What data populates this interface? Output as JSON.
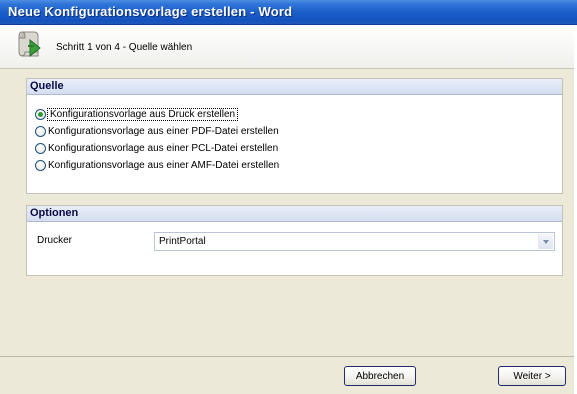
{
  "window": {
    "title": "Neue Konfigurationsvorlage erstellen - Word"
  },
  "header": {
    "step_text": "Schritt 1 von 4 - Quelle wählen",
    "icon": "wizard-scroll-arrow-icon"
  },
  "source_group": {
    "title": "Quelle",
    "options": [
      {
        "label": "Konfigurationsvorlage aus Druck erstellen",
        "selected": true
      },
      {
        "label": "Konfigurationsvorlage aus einer PDF-Datei erstellen",
        "selected": false
      },
      {
        "label": "Konfigurationsvorlage aus einer PCL-Datei erstellen",
        "selected": false
      },
      {
        "label": "Konfigurationsvorlage aus einer AMF-Datei erstellen",
        "selected": false
      }
    ]
  },
  "options_group": {
    "title": "Optionen",
    "printer_label": "Drucker",
    "printer_value": "PrintPortal"
  },
  "buttons": {
    "cancel": "Abbrechen",
    "next": "Weiter >"
  },
  "colors": {
    "titlebar": "#1a5cc8",
    "group_header": "#d4def0",
    "radio_selected": "#2e9a2e"
  }
}
